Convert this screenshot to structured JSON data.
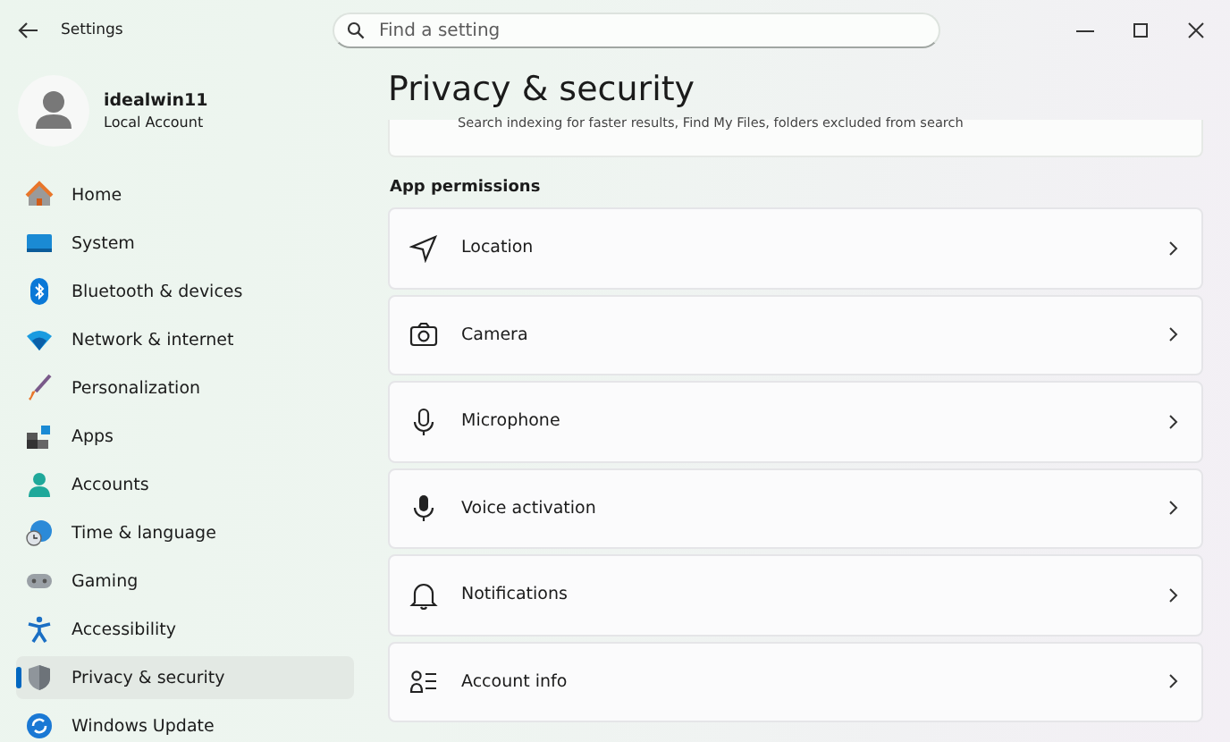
{
  "window": {
    "title": "Settings"
  },
  "search": {
    "placeholder": "Find a setting"
  },
  "account": {
    "name": "idealwin11",
    "type": "Local Account"
  },
  "sidebar": {
    "items": [
      {
        "label": "Home",
        "selected": false
      },
      {
        "label": "System",
        "selected": false
      },
      {
        "label": "Bluetooth & devices",
        "selected": false
      },
      {
        "label": "Network & internet",
        "selected": false
      },
      {
        "label": "Personalization",
        "selected": false
      },
      {
        "label": "Apps",
        "selected": false
      },
      {
        "label": "Accounts",
        "selected": false
      },
      {
        "label": "Time & language",
        "selected": false
      },
      {
        "label": "Gaming",
        "selected": false
      },
      {
        "label": "Accessibility",
        "selected": false
      },
      {
        "label": "Privacy & security",
        "selected": true
      },
      {
        "label": "Windows Update",
        "selected": false
      }
    ]
  },
  "page": {
    "title": "Privacy & security",
    "partial_card": {
      "description": "Search indexing for faster results, Find My Files, folders excluded from search"
    },
    "section": "App permissions",
    "cards": [
      {
        "label": "Location"
      },
      {
        "label": "Camera"
      },
      {
        "label": "Microphone"
      },
      {
        "label": "Voice activation"
      },
      {
        "label": "Notifications"
      },
      {
        "label": "Account info"
      }
    ]
  }
}
